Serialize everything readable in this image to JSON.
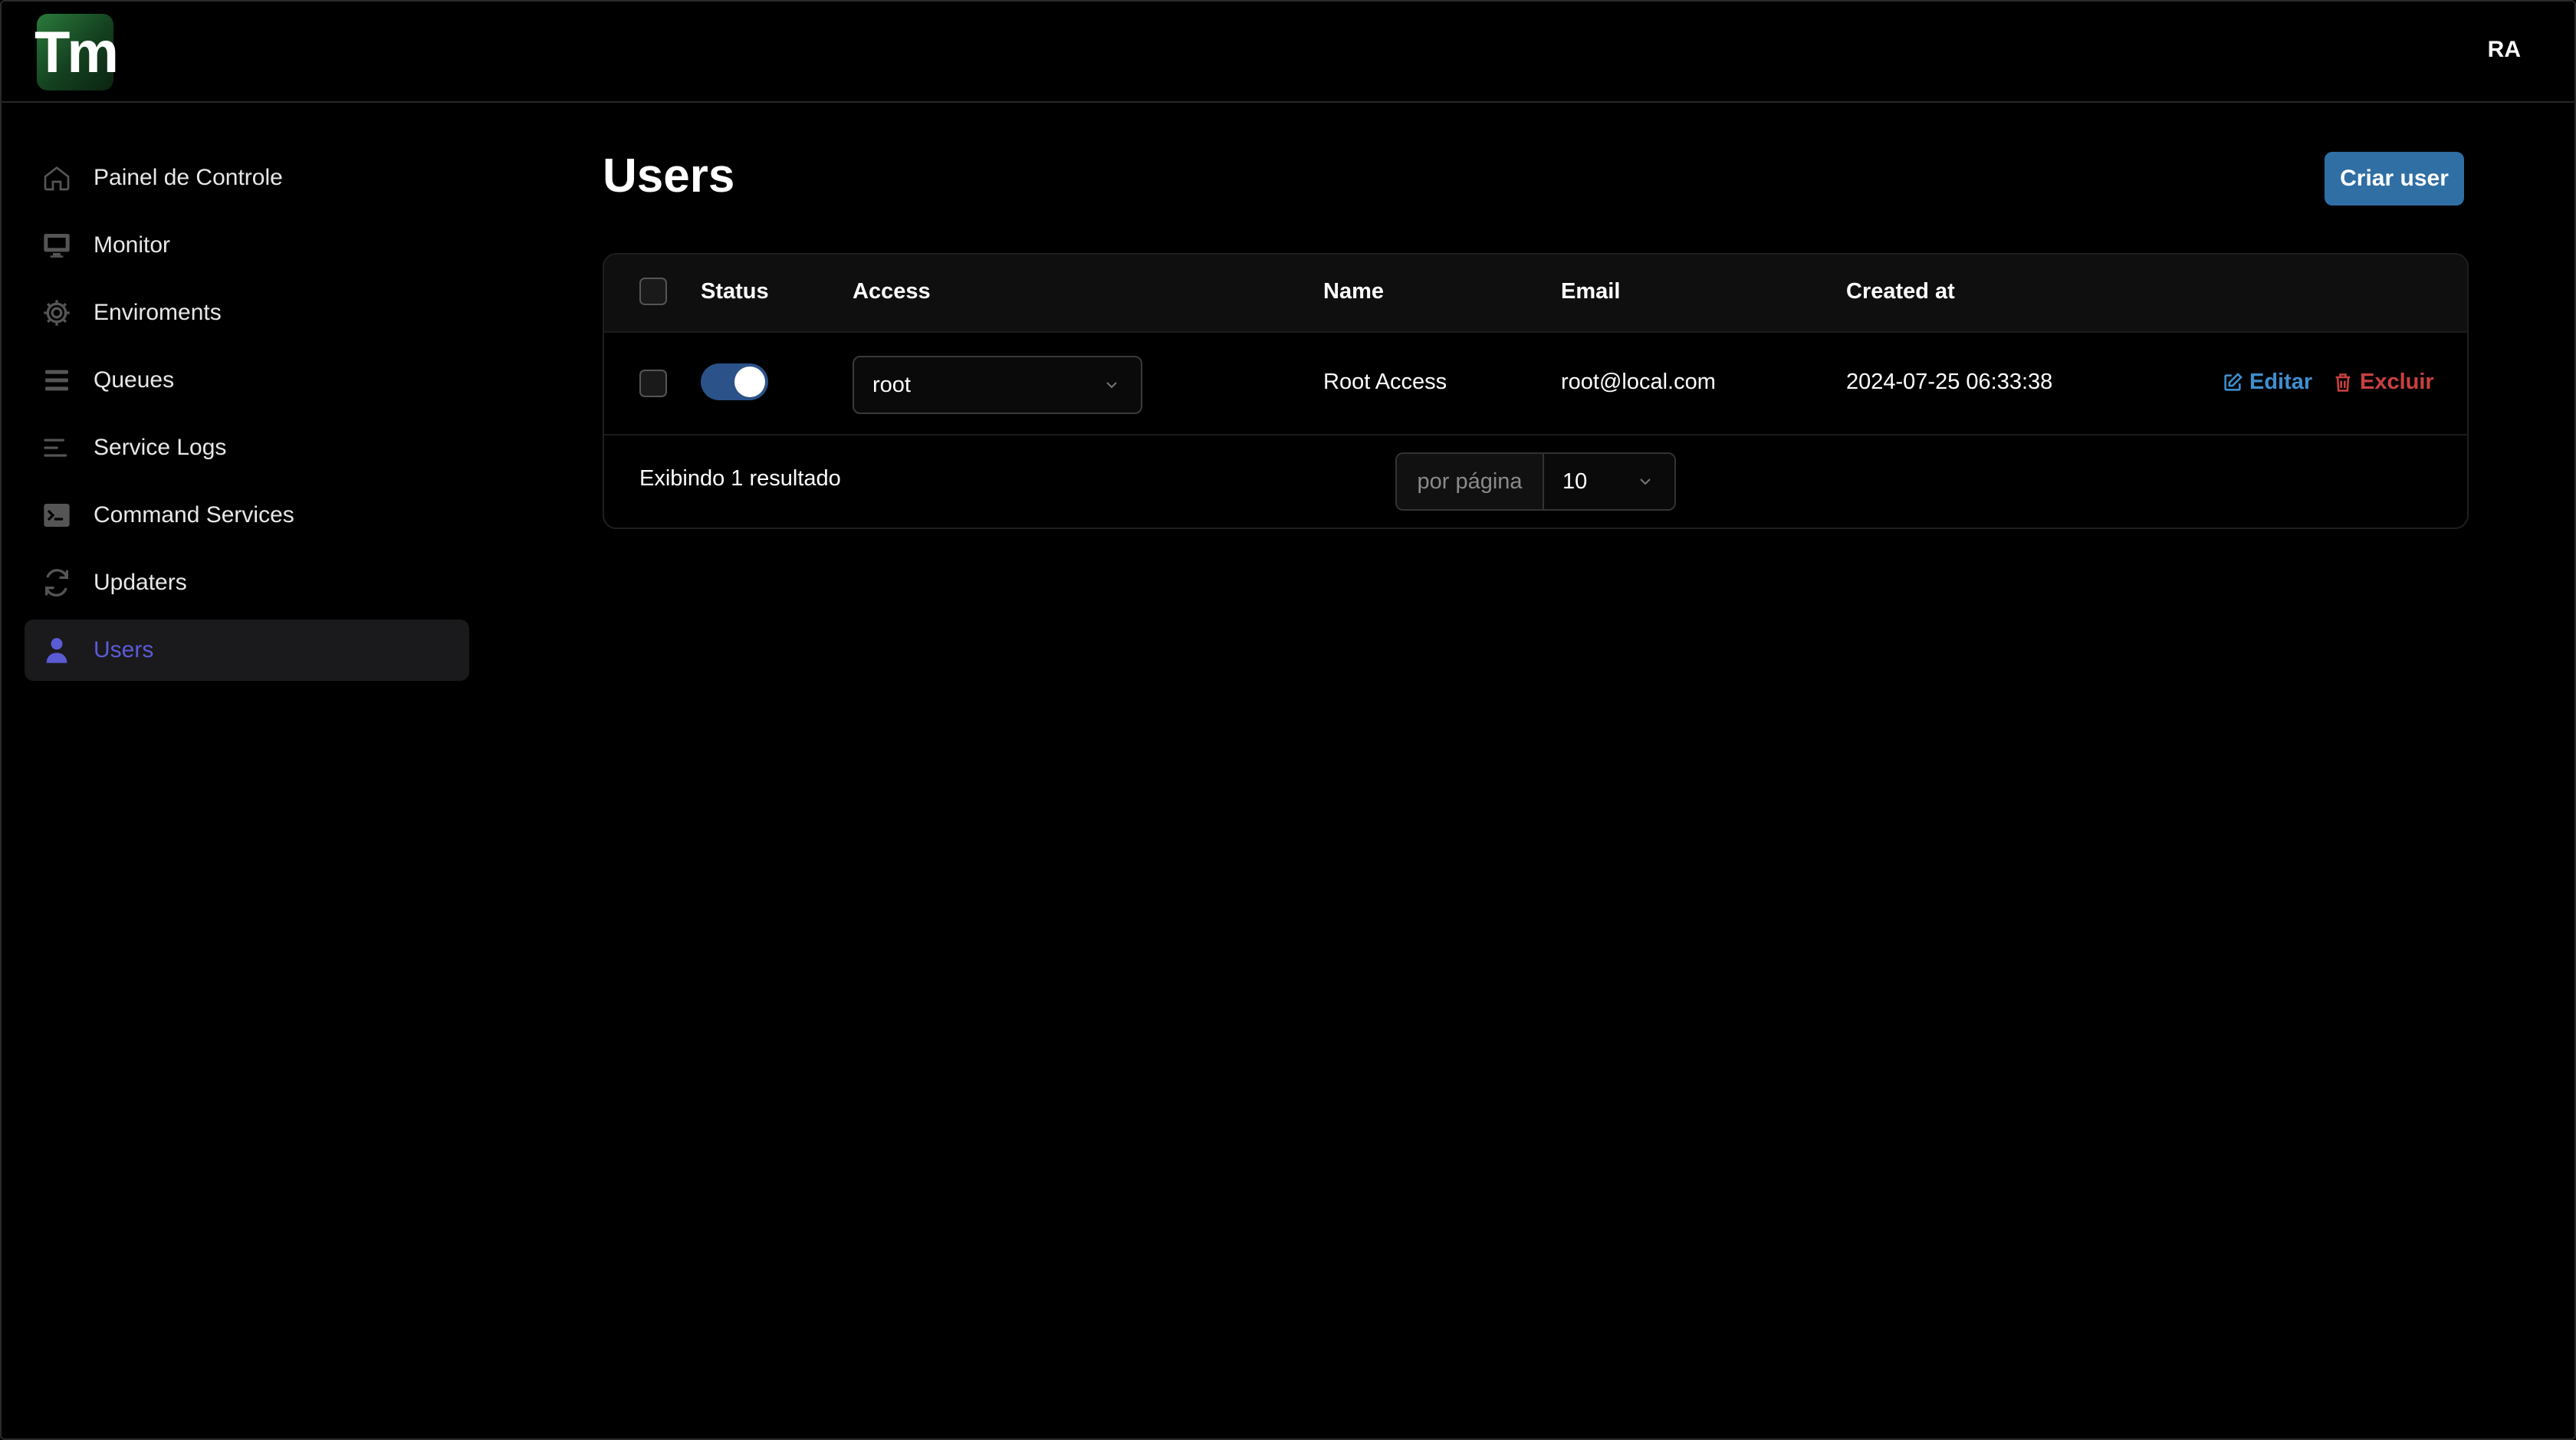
{
  "header": {
    "logo_text": "Tm",
    "user_initials": "RA"
  },
  "sidebar": {
    "items": [
      {
        "label": "Painel de Controle",
        "icon": "home-icon"
      },
      {
        "label": "Monitor",
        "icon": "monitor-icon"
      },
      {
        "label": "Enviroments",
        "icon": "gear-icon"
      },
      {
        "label": "Queues",
        "icon": "queue-icon"
      },
      {
        "label": "Service Logs",
        "icon": "logs-icon"
      },
      {
        "label": "Command Services",
        "icon": "terminal-icon"
      },
      {
        "label": "Updaters",
        "icon": "refresh-icon"
      },
      {
        "label": "Users",
        "icon": "user-icon",
        "active": true
      }
    ]
  },
  "main": {
    "title": "Users",
    "create_button": "Criar user",
    "table": {
      "headers": {
        "status": "Status",
        "access": "Access",
        "name": "Name",
        "email": "Email",
        "created_at": "Created at"
      },
      "rows": [
        {
          "status_enabled": true,
          "access": "root",
          "name": "Root Access",
          "email": "root@local.com",
          "created_at": "2024-07-25 06:33:38",
          "edit_label": "Editar",
          "delete_label": "Excluir"
        }
      ]
    },
    "footer": {
      "summary": "Exibindo 1 resultado",
      "per_page_label": "por página",
      "per_page_value": "10"
    }
  },
  "colors": {
    "accent": "#5b5bd6",
    "primary_button": "#2f6fa3",
    "edit": "#3e8fd0",
    "delete": "#c94040",
    "toggle_on": "#2b5289"
  }
}
